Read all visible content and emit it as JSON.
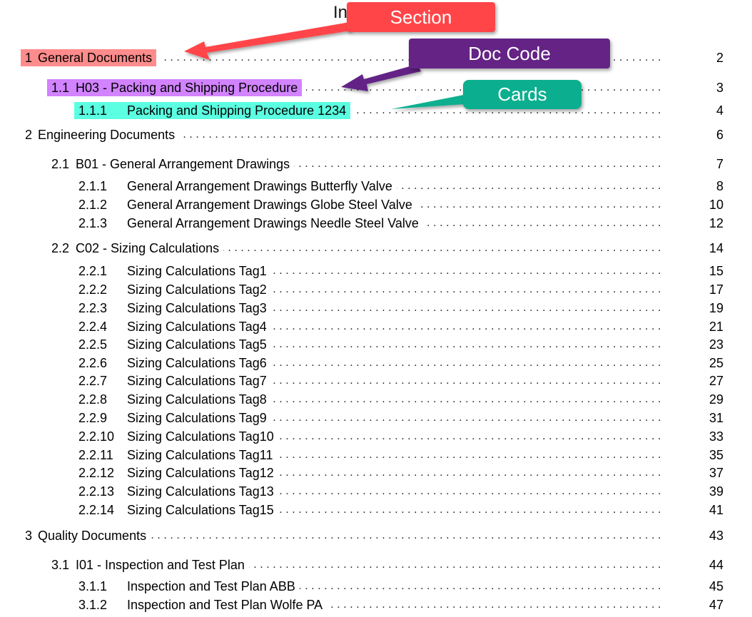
{
  "title": "Index of Ve",
  "annotations": {
    "section": {
      "label": "Section",
      "color": "#FF4548",
      "highlight": "#FF8C8C"
    },
    "doc_code": {
      "label": "Doc Code",
      "color": "#642385",
      "highlight": "#D283FF"
    },
    "cards": {
      "label": "Cards",
      "color": "#0BAF8F",
      "highlight": "#5BFFE1"
    }
  },
  "toc": [
    {
      "num": "1",
      "text": "General Documents",
      "page": "2",
      "level": 1
    },
    {
      "num": "1.1",
      "text": "H03 - Packing and Shipping Procedure",
      "page": "3",
      "level": 2
    },
    {
      "num": "1.1.1",
      "text": "Packing and Shipping Procedure 1234",
      "page": "4",
      "level": 3
    },
    {
      "num": "2",
      "text": "Engineering Documents",
      "page": "6",
      "level": 1
    },
    {
      "num": "2.1",
      "text": "B01 - General Arrangement Drawings",
      "page": "7",
      "level": 2
    },
    {
      "num": "2.1.1",
      "text": "General Arrangement Drawings Butterfly Valve",
      "page": "8",
      "level": 3
    },
    {
      "num": "2.1.2",
      "text": "General Arrangement Drawings Globe Steel Valve",
      "page": "10",
      "level": 3
    },
    {
      "num": "2.1.3",
      "text": "General Arrangement Drawings Needle Steel Valve",
      "page": "12",
      "level": 3
    },
    {
      "num": "2.2",
      "text": "C02 - Sizing Calculations",
      "page": "14",
      "level": 2
    },
    {
      "num": "2.2.1",
      "text": "Sizing Calculations Tag1",
      "page": "15",
      "level": 3
    },
    {
      "num": "2.2.2",
      "text": "Sizing Calculations Tag2",
      "page": "17",
      "level": 3
    },
    {
      "num": "2.2.3",
      "text": "Sizing Calculations Tag3",
      "page": "19",
      "level": 3
    },
    {
      "num": "2.2.4",
      "text": "Sizing Calculations Tag4",
      "page": "21",
      "level": 3
    },
    {
      "num": "2.2.5",
      "text": "Sizing Calculations Tag5",
      "page": "23",
      "level": 3
    },
    {
      "num": "2.2.6",
      "text": "Sizing Calculations Tag6",
      "page": "25",
      "level": 3
    },
    {
      "num": "2.2.7",
      "text": "Sizing Calculations Tag7",
      "page": "27",
      "level": 3
    },
    {
      "num": "2.2.8",
      "text": "Sizing Calculations Tag8",
      "page": "29",
      "level": 3
    },
    {
      "num": "2.2.9",
      "text": "Sizing Calculations Tag9",
      "page": "31",
      "level": 3
    },
    {
      "num": "2.2.10",
      "text": "Sizing Calculations Tag10",
      "page": "33",
      "level": 3
    },
    {
      "num": "2.2.11",
      "text": "Sizing Calculations Tag11",
      "page": "35",
      "level": 3
    },
    {
      "num": "2.2.12",
      "text": "Sizing Calculations Tag12",
      "page": "37",
      "level": 3
    },
    {
      "num": "2.2.13",
      "text": "Sizing Calculations Tag13",
      "page": "39",
      "level": 3
    },
    {
      "num": "2.2.14",
      "text": "Sizing Calculations Tag15",
      "page": "41",
      "level": 3
    },
    {
      "num": "3",
      "text": "Quality Documents",
      "page": "43",
      "level": 1
    },
    {
      "num": "3.1",
      "text": "I01 - Inspection and Test Plan",
      "page": "44",
      "level": 2
    },
    {
      "num": "3.1.1",
      "text": "Inspection and Test Plan ABB",
      "page": "45",
      "level": 3
    },
    {
      "num": "3.1.2",
      "text": "Inspection and Test Plan Wolfe PA",
      "page": "47",
      "level": 3
    }
  ]
}
